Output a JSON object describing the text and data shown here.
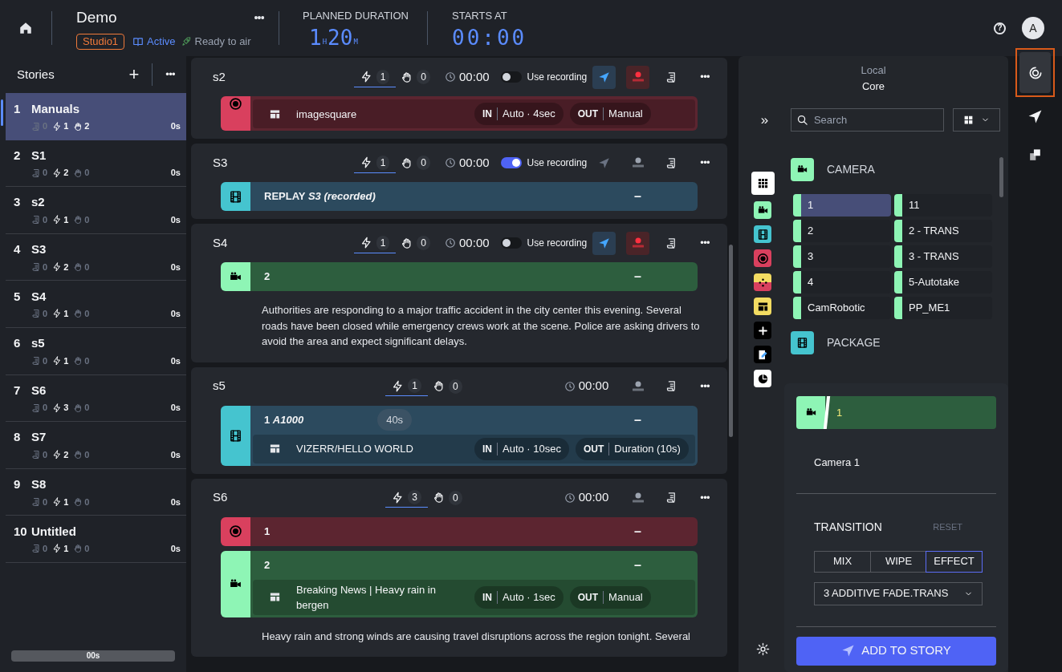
{
  "topbar": {
    "title": "Demo",
    "studio": "Studio1",
    "status": "Active",
    "readiness": "Ready to air",
    "more": "•••",
    "planned_duration": {
      "label": "PLANNED DURATION",
      "parts": [
        "1",
        "H",
        "20",
        "M"
      ]
    },
    "starts_at": {
      "label": "STARTS AT",
      "value": "00:00"
    },
    "help": "?",
    "avatar": "A"
  },
  "stories": {
    "title": "Stories",
    "add": "+",
    "more": "•••",
    "items": [
      {
        "number": "1",
        "title": "Manuals",
        "selected": true,
        "counts": [
          {
            "kind": "script",
            "value": "0",
            "dim": true
          },
          {
            "kind": "trigger",
            "value": "1",
            "dim": false
          },
          {
            "kind": "manual",
            "value": "2",
            "dim": false
          }
        ],
        "duration": "0s"
      },
      {
        "number": "2",
        "title": "S1",
        "selected": false,
        "counts": [
          {
            "kind": "script",
            "value": "0",
            "dim": true
          },
          {
            "kind": "trigger",
            "value": "2",
            "dim": false
          },
          {
            "kind": "manual",
            "value": "0",
            "dim": true
          }
        ],
        "duration": "0s"
      },
      {
        "number": "3",
        "title": "s2",
        "selected": false,
        "counts": [
          {
            "kind": "script",
            "value": "0",
            "dim": true
          },
          {
            "kind": "trigger",
            "value": "1",
            "dim": false
          },
          {
            "kind": "manual",
            "value": "0",
            "dim": true
          }
        ],
        "duration": "0s"
      },
      {
        "number": "4",
        "title": "S3",
        "selected": false,
        "counts": [
          {
            "kind": "script",
            "value": "0",
            "dim": true
          },
          {
            "kind": "trigger",
            "value": "2",
            "dim": false
          },
          {
            "kind": "manual",
            "value": "0",
            "dim": true
          }
        ],
        "duration": "0s"
      },
      {
        "number": "5",
        "title": "S4",
        "selected": false,
        "counts": [
          {
            "kind": "script",
            "value": "0",
            "dim": true
          },
          {
            "kind": "trigger",
            "value": "1",
            "dim": false
          },
          {
            "kind": "manual",
            "value": "0",
            "dim": true
          }
        ],
        "duration": "0s"
      },
      {
        "number": "6",
        "title": "s5",
        "selected": false,
        "counts": [
          {
            "kind": "script",
            "value": "0",
            "dim": true
          },
          {
            "kind": "trigger",
            "value": "1",
            "dim": false
          },
          {
            "kind": "manual",
            "value": "0",
            "dim": true
          }
        ],
        "duration": "0s"
      },
      {
        "number": "7",
        "title": "S6",
        "selected": false,
        "counts": [
          {
            "kind": "script",
            "value": "0",
            "dim": true
          },
          {
            "kind": "trigger",
            "value": "3",
            "dim": false
          },
          {
            "kind": "manual",
            "value": "0",
            "dim": true
          }
        ],
        "duration": "0s"
      },
      {
        "number": "8",
        "title": "S7",
        "selected": false,
        "counts": [
          {
            "kind": "script",
            "value": "0",
            "dim": true
          },
          {
            "kind": "trigger",
            "value": "2",
            "dim": false
          },
          {
            "kind": "manual",
            "value": "0",
            "dim": true
          }
        ],
        "duration": "0s"
      },
      {
        "number": "9",
        "title": "S8",
        "selected": false,
        "counts": [
          {
            "kind": "script",
            "value": "0",
            "dim": true
          },
          {
            "kind": "trigger",
            "value": "1",
            "dim": false
          },
          {
            "kind": "manual",
            "value": "0",
            "dim": true
          }
        ],
        "duration": "0s"
      },
      {
        "number": "10",
        "title": "Untitled",
        "selected": false,
        "counts": [
          {
            "kind": "script",
            "value": "0",
            "dim": true
          },
          {
            "kind": "trigger",
            "value": "1",
            "dim": false
          },
          {
            "kind": "manual",
            "value": "0",
            "dim": true
          }
        ],
        "duration": "0s"
      }
    ],
    "total": "00s"
  },
  "rundown": [
    {
      "title": "s2",
      "triggers": "1",
      "manual": "0",
      "time": "00:00",
      "use_recording": {
        "label": "Use recording",
        "on": false
      },
      "send": {
        "enabled": true
      },
      "rec": {
        "enabled": true
      },
      "more": "•••",
      "items": [
        {
          "kind": "record",
          "sub": {
            "name": "imagesquare",
            "in_label": "IN",
            "in_value": "Auto · 4sec",
            "out_label": "OUT",
            "out_value": "Manual"
          }
        }
      ]
    },
    {
      "title": "S3",
      "triggers": "1",
      "manual": "0",
      "time": "00:00",
      "use_recording": {
        "label": "Use recording",
        "on": true
      },
      "send": {
        "enabled": false
      },
      "rec": {
        "enabled": false
      },
      "more": "•••",
      "items": [
        {
          "kind": "package",
          "title": "REPLAY *S3 (recorded)*",
          "status": "–"
        }
      ]
    },
    {
      "title": "S4",
      "triggers": "1",
      "manual": "0",
      "time": "00:00",
      "use_recording": {
        "label": "Use recording",
        "on": false
      },
      "send": {
        "enabled": true
      },
      "rec": {
        "enabled": true
      },
      "more": "•••",
      "items": [
        {
          "kind": "camera",
          "title": "2",
          "status": "–"
        }
      ],
      "text": "Authorities are responding to a major traffic accident in the city center this evening. Several roads have been closed while emergency crews work at the scene. Police are asking drivers to avoid the area and expect significant delays."
    },
    {
      "title": "s5",
      "triggers": "1",
      "manual": "0",
      "time": "00:00",
      "rec": {
        "enabled": false
      },
      "more": "•••",
      "items": [
        {
          "kind": "package",
          "title": "1 *A1000*",
          "duration": "40s",
          "status": "–",
          "sub": {
            "name": "VIZERR/HELLO WORLD",
            "in_label": "IN",
            "in_value": "Auto · 10sec",
            "out_label": "OUT",
            "out_value": "Duration (10s)"
          }
        }
      ]
    },
    {
      "title": "S6",
      "triggers": "3",
      "manual": "0",
      "time": "00:00",
      "rec": {
        "enabled": false
      },
      "more": "•••",
      "items": [
        {
          "kind": "record",
          "title": "1",
          "status": "–"
        },
        {
          "kind": "camera",
          "title": "2",
          "status": "–",
          "sub": {
            "name": "Breaking News | Heavy rain in bergen",
            "in_label": "IN",
            "in_value": "Auto · 1sec",
            "out_label": "OUT",
            "out_value": "Manual"
          }
        }
      ],
      "text": "Heavy rain and strong winds are causing travel disruptions across the region tonight. Several"
    }
  ],
  "library": {
    "source": "Local",
    "engine": "Core",
    "expand": "»",
    "search": {
      "placeholder": "Search"
    },
    "filters": [
      {
        "kind": "all",
        "selected": true
      },
      {
        "kind": "camera",
        "selected": false
      },
      {
        "kind": "package",
        "selected": false
      },
      {
        "kind": "record",
        "selected": false
      },
      {
        "kind": "move",
        "selected": false
      },
      {
        "kind": "layout",
        "selected": false
      },
      {
        "kind": "add",
        "selected": false
      },
      {
        "kind": "edit",
        "selected": false
      },
      {
        "kind": "clock",
        "selected": false
      }
    ],
    "categories": [
      {
        "kind": "camera",
        "label": "CAMERA",
        "items": [
          {
            "label": "1",
            "selected": true
          },
          {
            "label": "11",
            "selected": false
          },
          {
            "label": "2",
            "selected": false
          },
          {
            "label": "2 - TRANS",
            "selected": false
          },
          {
            "label": "3",
            "selected": false
          },
          {
            "label": "3 - TRANS",
            "selected": false
          },
          {
            "label": "4",
            "selected": false
          },
          {
            "label": "5-Autotake",
            "selected": false
          },
          {
            "label": "CamRobotic",
            "selected": false
          },
          {
            "label": "PP_ME1",
            "selected": false
          }
        ]
      },
      {
        "kind": "package",
        "label": "PACKAGE"
      }
    ]
  },
  "detail": {
    "kind": "camera",
    "title": "1",
    "description": "Camera 1",
    "transition": {
      "label": "TRANSITION",
      "reset": "RESET",
      "options": [
        {
          "label": "MIX",
          "selected": false
        },
        {
          "label": "WIPE",
          "selected": false
        },
        {
          "label": "EFFECT",
          "selected": true
        }
      ],
      "effect": "3 ADDITIVE FADE.TRANS"
    },
    "action": "ADD TO STORY"
  },
  "rail": [
    {
      "kind": "swirl",
      "selected": true
    },
    {
      "kind": "send",
      "selected": false
    },
    {
      "kind": "copy",
      "selected": false
    }
  ]
}
